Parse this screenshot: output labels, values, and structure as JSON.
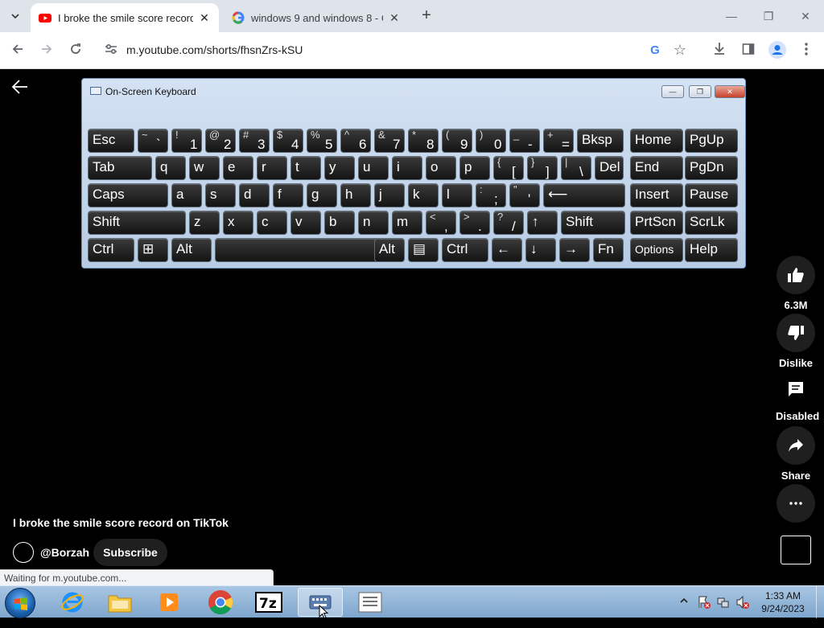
{
  "browser": {
    "tabs": [
      {
        "title": "I broke the smile score record",
        "favicon": "youtube-icon",
        "active": true
      },
      {
        "title": "windows 9 and windows 8 - G",
        "favicon": "google-icon",
        "active": false
      }
    ],
    "url": "m.youtube.com/shorts/fhsnZrs-kSU"
  },
  "osk": {
    "title": "On-Screen Keyboard",
    "rows": [
      [
        {
          "label": "Esc"
        },
        {
          "sup": "~",
          "main": "`"
        },
        {
          "sup": "!",
          "main": "1"
        },
        {
          "sup": "@",
          "main": "2"
        },
        {
          "sup": "#",
          "main": "3"
        },
        {
          "sup": "$",
          "main": "4"
        },
        {
          "sup": "%",
          "main": "5"
        },
        {
          "sup": "^",
          "main": "6"
        },
        {
          "sup": "&",
          "main": "7"
        },
        {
          "sup": "*",
          "main": "8"
        },
        {
          "sup": "(",
          "main": "9"
        },
        {
          "sup": ")",
          "main": "0"
        },
        {
          "sup": "_",
          "main": "-"
        },
        {
          "sup": "+",
          "main": "="
        },
        {
          "label": "Bksp"
        },
        {
          "label": "Home"
        },
        {
          "label": "PgUp"
        }
      ],
      [
        {
          "label": "Tab"
        },
        {
          "label": "q"
        },
        {
          "label": "w"
        },
        {
          "label": "e"
        },
        {
          "label": "r"
        },
        {
          "label": "t"
        },
        {
          "label": "y"
        },
        {
          "label": "u"
        },
        {
          "label": "i"
        },
        {
          "label": "o"
        },
        {
          "label": "p"
        },
        {
          "sup": "{",
          "main": "["
        },
        {
          "sup": "}",
          "main": "]"
        },
        {
          "sup": "|",
          "main": "\\"
        },
        {
          "label": "Del"
        },
        {
          "label": "End"
        },
        {
          "label": "PgDn"
        }
      ],
      [
        {
          "label": "Caps"
        },
        {
          "label": "a"
        },
        {
          "label": "s"
        },
        {
          "label": "d"
        },
        {
          "label": "f"
        },
        {
          "label": "g"
        },
        {
          "label": "h"
        },
        {
          "label": "j"
        },
        {
          "label": "k"
        },
        {
          "label": "l"
        },
        {
          "sup": ":",
          "main": ";"
        },
        {
          "sup": "\"",
          "main": "'"
        },
        {
          "label": "⟵"
        },
        {
          "label": "Insert"
        },
        {
          "label": "Pause"
        }
      ],
      [
        {
          "label": "Shift"
        },
        {
          "label": "z"
        },
        {
          "label": "x"
        },
        {
          "label": "c"
        },
        {
          "label": "v"
        },
        {
          "label": "b"
        },
        {
          "label": "n"
        },
        {
          "label": "m"
        },
        {
          "sup": "<",
          "main": ","
        },
        {
          "sup": ">",
          "main": "."
        },
        {
          "sup": "?",
          "main": "/"
        },
        {
          "label": "↑"
        },
        {
          "label": "Shift"
        },
        {
          "label": "PrtScn"
        },
        {
          "label": "ScrLk"
        }
      ],
      [
        {
          "label": "Ctrl"
        },
        {
          "label": "⊞"
        },
        {
          "label": "Alt"
        },
        {
          "label": ""
        },
        {
          "label": "Alt"
        },
        {
          "label": "▤"
        },
        {
          "label": "Ctrl"
        },
        {
          "label": "←"
        },
        {
          "label": "↓"
        },
        {
          "label": "→"
        },
        {
          "label": "Fn"
        },
        {
          "label": "Options"
        },
        {
          "label": "Help"
        }
      ]
    ]
  },
  "video": {
    "title": "I broke the smile score record on TikTok",
    "channel": "@Borzah",
    "subscribe": "Subscribe",
    "like_count": "6.3M",
    "dislike": "Dislike",
    "comments": "Disabled",
    "share": "Share"
  },
  "status": "Waiting for m.youtube.com...",
  "taskbar": {
    "time": "1:33 AM",
    "date": "9/24/2023"
  }
}
